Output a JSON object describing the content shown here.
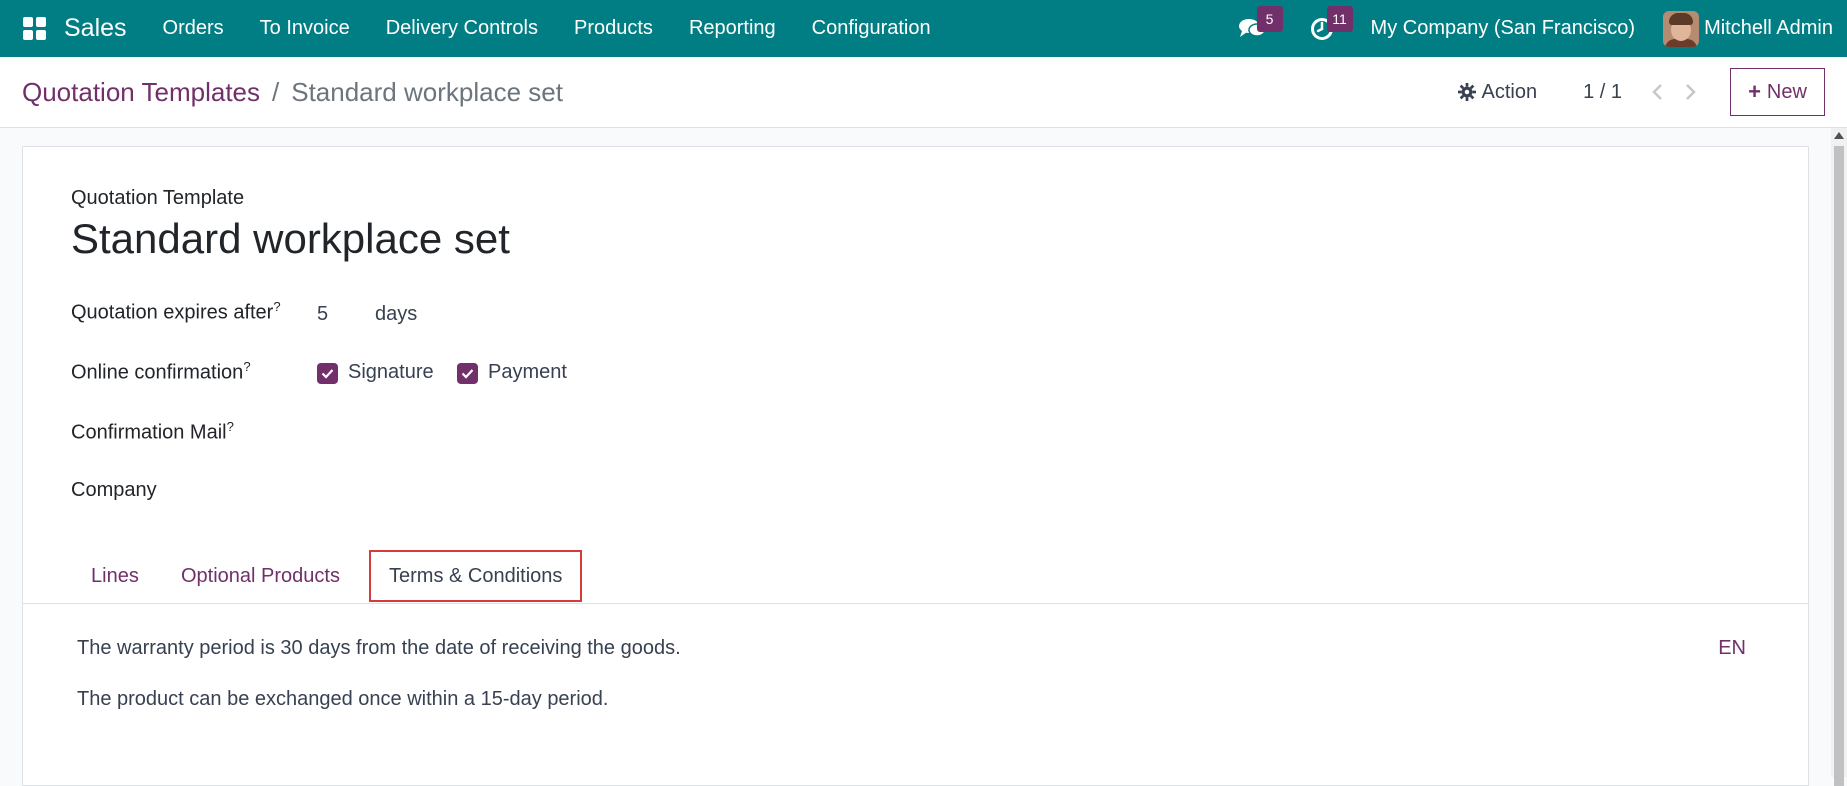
{
  "navbar": {
    "app_name": "Sales",
    "menu": [
      "Orders",
      "To Invoice",
      "Delivery Controls",
      "Products",
      "Reporting",
      "Configuration"
    ],
    "messages_count": "5",
    "activities_count": "11",
    "company": "My Company (San Francisco)",
    "user": "Mitchell Admin",
    "bg_color": "#017e84"
  },
  "control_panel": {
    "breadcrumb_parent": "Quotation Templates",
    "breadcrumb_sep": "/",
    "breadcrumb_current": "Standard workplace set",
    "action_label": "Action",
    "pager": "1 / 1",
    "new_label": "New"
  },
  "form": {
    "header_label": "Quotation Template",
    "title": "Standard workplace set",
    "expires_label": "Quotation expires after",
    "expires_value": "5",
    "expires_unit": "days",
    "online_confirmation_label": "Online confirmation",
    "signature_label": "Signature",
    "signature_checked": true,
    "payment_label": "Payment",
    "payment_checked": true,
    "confirmation_mail_label": "Confirmation Mail",
    "company_label": "Company",
    "help_mark": "?"
  },
  "tabs": {
    "lines": "Lines",
    "optional_products": "Optional Products",
    "terms": "Terms & Conditions",
    "active": "terms"
  },
  "terms": {
    "line1": "The warranty period is 30 days from the date of receiving the goods.",
    "line2": "The product can be exchanged once within a 15-day period.",
    "lang": "EN"
  },
  "colors": {
    "accent": "#71306a",
    "highlight": "#d43b3b"
  }
}
